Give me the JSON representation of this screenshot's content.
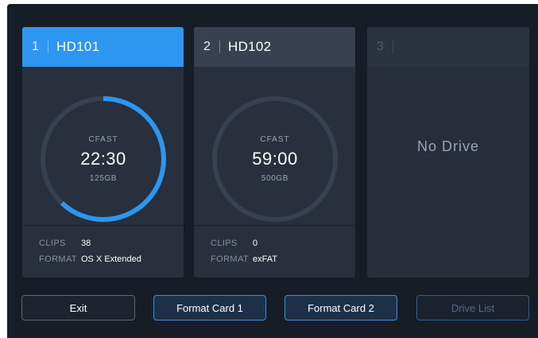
{
  "drives": [
    {
      "slot": "1",
      "name": "HD101",
      "media": "CFAST",
      "time": "22:30",
      "capacity": "125GB",
      "used_fraction": 0.62,
      "clips_label": "CLIPS",
      "clips": "38",
      "format_label": "FORMAT",
      "format": "OS X Extended"
    },
    {
      "slot": "2",
      "name": "HD102",
      "media": "CFAST",
      "time": "59:00",
      "capacity": "500GB",
      "used_fraction": 0,
      "clips_label": "CLIPS",
      "clips": "0",
      "format_label": "FORMAT",
      "format": "exFAT"
    },
    {
      "slot": "3",
      "status": "No Drive"
    }
  ],
  "buttons": {
    "exit": "Exit",
    "format_card_1": "Format Card 1",
    "format_card_2": "Format Card 2",
    "drive_list": "Drive List"
  },
  "colors": {
    "accent": "#2d96f1",
    "ring_track": "#37414f",
    "background": "#161d26"
  }
}
